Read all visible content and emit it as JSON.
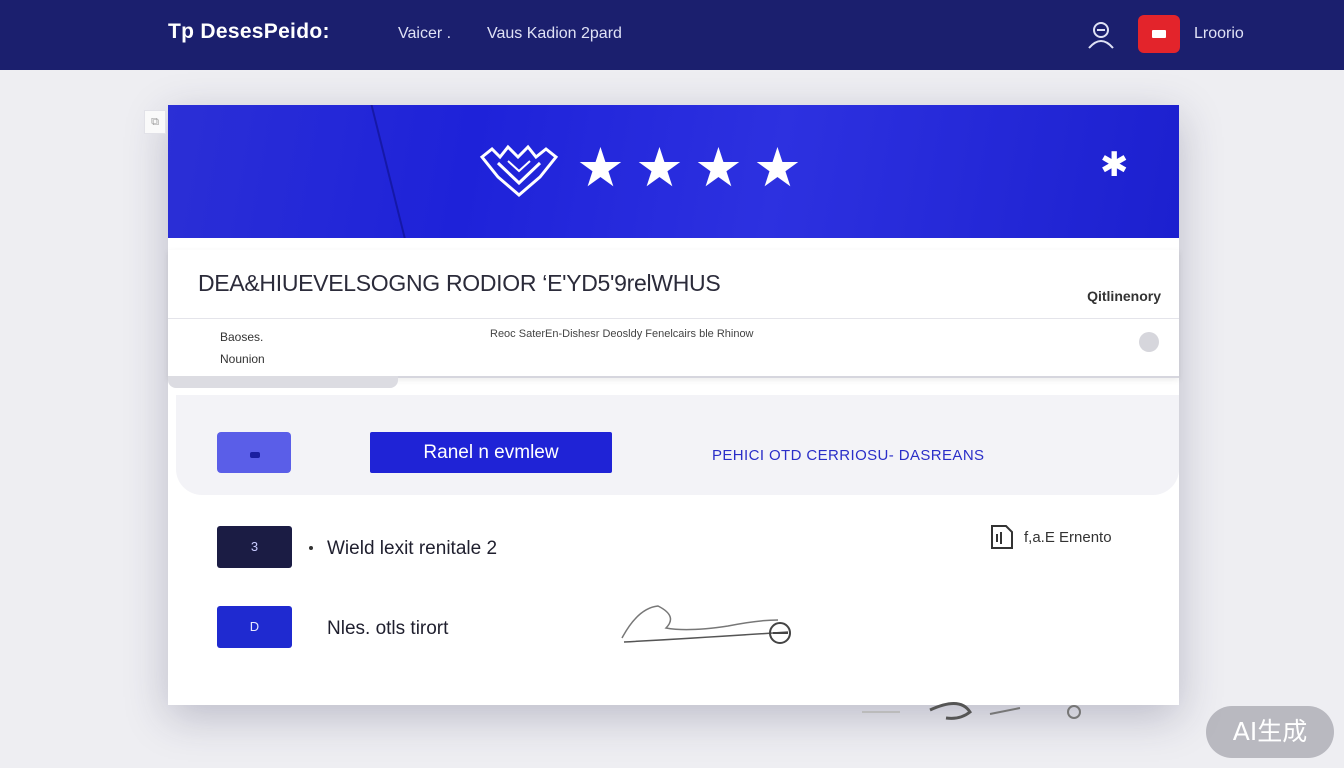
{
  "header": {
    "brand": "Tp DesesPeido:",
    "nav": [
      "Vaicer .",
      "Vaus Kadion 2pard"
    ],
    "user_name": "Lroorio"
  },
  "hero": {
    "rating_stars": 4
  },
  "info": {
    "title": "DEA&HIUEVELSOGNG RODIOR ‘E'YD5'9relWHUS",
    "status": "Qitlinenory",
    "meta": [
      "Baoses.",
      "Nounion"
    ],
    "description": "Reoc SaterEn-Dishesr Deosldy Fenelcairs ble Rhinow"
  },
  "toolbar": {
    "primary_label": "Ranel n evmlew",
    "link_label": "PEHICI OTD CERRIOSU- DASREANS"
  },
  "rows": [
    {
      "badge": "3",
      "label": "Wield lexit renitale 2"
    },
    {
      "badge": "D",
      "label": "Nles. otls tirort"
    }
  ],
  "side_action": {
    "label": "f,a.E Ernento"
  },
  "watermark": "AI生成",
  "colors": {
    "topbar": "#1b1f6e",
    "hero": "#2226d8",
    "accent": "#1f23d6",
    "notification": "#e3242b"
  }
}
